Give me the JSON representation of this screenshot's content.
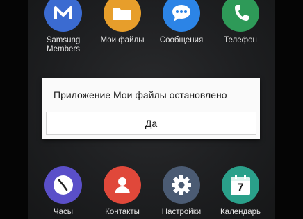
{
  "top_apps": [
    {
      "label": "Samsung\nMembers",
      "icon": "samsung-members-icon",
      "color": "#3b6bd1"
    },
    {
      "label": "Мои файлы",
      "icon": "folder-icon",
      "color": "#e79e2b"
    },
    {
      "label": "Сообщения",
      "icon": "chat-icon",
      "color": "#2c84e6"
    },
    {
      "label": "Телефон",
      "icon": "phone-icon",
      "color": "#2e9a58"
    }
  ],
  "bottom_apps": [
    {
      "label": "Часы",
      "icon": "clock-icon",
      "color": "#5a4fc9"
    },
    {
      "label": "Контакты",
      "icon": "contact-icon",
      "color": "#e0483a"
    },
    {
      "label": "Настройки",
      "icon": "gear-icon",
      "color": "#4b5b73"
    },
    {
      "label": "Календарь",
      "icon": "calendar-icon",
      "color": "#2aa08a"
    }
  ],
  "dialog": {
    "message": "Приложение Мои файлы остановлено",
    "ok_label": "Да"
  },
  "calendar_day": "7"
}
